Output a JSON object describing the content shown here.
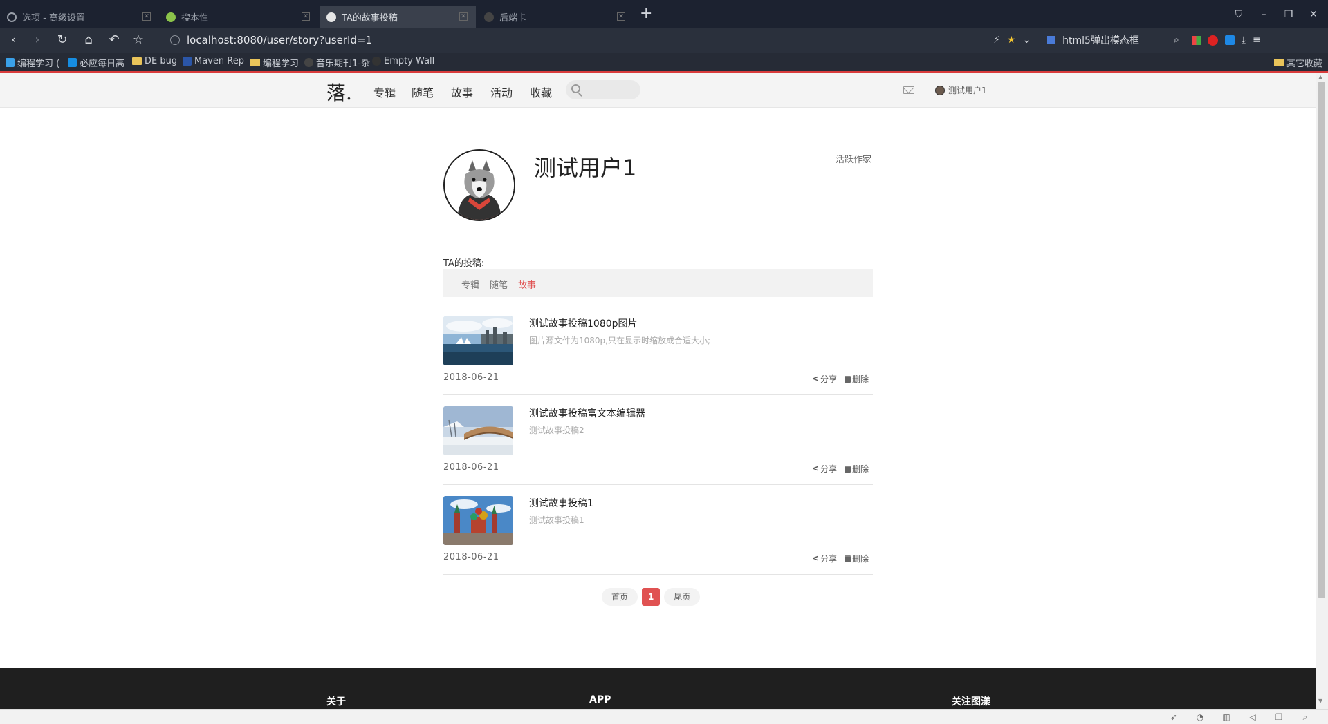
{
  "browser": {
    "tabs": [
      {
        "title": "选项 - 高级设置",
        "icon": "gear-icon"
      },
      {
        "title": "搜本性",
        "icon": "leaf-icon"
      },
      {
        "title": "TA的故事投稿",
        "icon": "site-icon"
      },
      {
        "title": "后端卡",
        "icon": "site-icon"
      }
    ],
    "url": "localhost:8080/user/story?userId=1",
    "search_engine_label": "html5弹出模态框",
    "bookmarks": [
      "编程学习 (",
      "必应每日高",
      "DE bug",
      "Maven Rep",
      "编程学习",
      "音乐期刊1-杂",
      "Empty Wall"
    ],
    "bookmarks_right": "其它收藏"
  },
  "site": {
    "logo": "落.",
    "nav": [
      "专辑",
      "随笔",
      "故事",
      "活动",
      "收藏"
    ],
    "user_name": "测试用户1"
  },
  "profile": {
    "name": "测试用户1",
    "badge": "活跃作家",
    "section_title": "TA的投稿:",
    "filters": [
      "专辑",
      "随笔",
      "故事"
    ],
    "selected_filter": "故事"
  },
  "stories": [
    {
      "title": "测试故事投稿1080p图片",
      "desc": "图片源文件为1080p,只在显示时缩放成合适大小;",
      "date": "2018-06-21",
      "share": "分享",
      "delete": "删除",
      "thumb": "opera-house-harbor"
    },
    {
      "title": "测试故事投稿富文本编辑器",
      "desc": "测试故事投稿2",
      "date": "2018-06-21",
      "share": "分享",
      "delete": "删除",
      "thumb": "snowy-bridge"
    },
    {
      "title": "测试故事投稿1",
      "desc": "测试故事投稿1",
      "date": "2018-06-21",
      "share": "分享",
      "delete": "删除",
      "thumb": "cathedral-square"
    }
  ],
  "pager": {
    "first": "首页",
    "current": "1",
    "last": "尾页"
  },
  "footer": {
    "headings": [
      "关于",
      "APP",
      "关注图漾"
    ]
  },
  "colors": {
    "accent": "#e05252",
    "browser_dark": "#1c2230",
    "footer": "#1f1f1f"
  }
}
